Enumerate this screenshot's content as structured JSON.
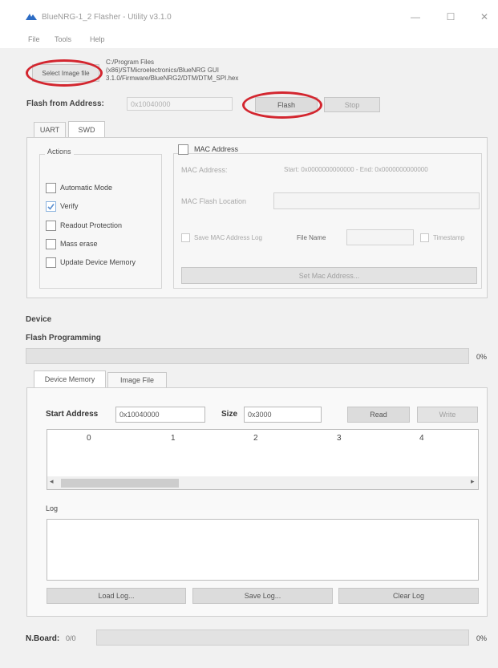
{
  "window": {
    "title": "BlueNRG-1_2 Flasher - Utility v3.1.0",
    "minimize": "—",
    "maximize": "☐",
    "close": "✕"
  },
  "menu": [
    "File",
    "Tools",
    "Help"
  ],
  "file_section": {
    "select_button": "Select Image file",
    "path_lines": [
      "C:/Program Files",
      "(x86)/STMicroelectronics/BlueNRG GUI",
      "3.1.0/Firmware/BlueNRG2/DTM/DTM_SPI.hex"
    ]
  },
  "flash_from": {
    "label": "Flash from Address:",
    "value": "0x10040000",
    "flash_button": "Flash",
    "stop_button": "Stop"
  },
  "tabs": [
    "UART",
    "SWD"
  ],
  "actions": {
    "title": "Actions",
    "items": [
      {
        "label": "Automatic Mode",
        "checked": false
      },
      {
        "label": "Verify",
        "checked": true
      },
      {
        "label": "Readout Protection",
        "checked": false
      },
      {
        "label": "Mass erase",
        "checked": false
      },
      {
        "label": "Update Device Memory",
        "checked": false
      }
    ]
  },
  "mac": {
    "checkbox_label": "MAC Address",
    "address_label": "MAC Address:",
    "address_range": "Start: 0x0000000000000 - End: 0x0000000000000",
    "location_label": "MAC Flash Location",
    "save_log_label": "Save MAC Address Log",
    "file_name_label": "File Name",
    "timestamp_label": "Timestamp",
    "set_button": "Set Mac Address..."
  },
  "device": {
    "label": "Device",
    "flash_programming": "Flash Programming",
    "progress_percent": "0%",
    "progress_value": 0
  },
  "memory_tabs": [
    "Device Memory",
    "Image File"
  ],
  "memory": {
    "start_label": "Start Address",
    "start_value": "0x10040000",
    "size_label": "Size",
    "size_value": "0x3000",
    "read_button": "Read",
    "write_button": "Write",
    "columns": [
      "0",
      "1",
      "2",
      "3",
      "4"
    ],
    "scroll_left": "◂",
    "scroll_right": "▸"
  },
  "log": {
    "label": "Log",
    "load_button": "Load Log...",
    "save_button": "Save Log...",
    "clear_button": "Clear Log"
  },
  "footer": {
    "boards_label": "N.Board:",
    "boards_value": "0/0",
    "percent": "0%"
  },
  "colors": {
    "highlight_oval": "#d3262f",
    "background": "#f1f1f1",
    "checkbox_check": "#5b8fd0"
  }
}
